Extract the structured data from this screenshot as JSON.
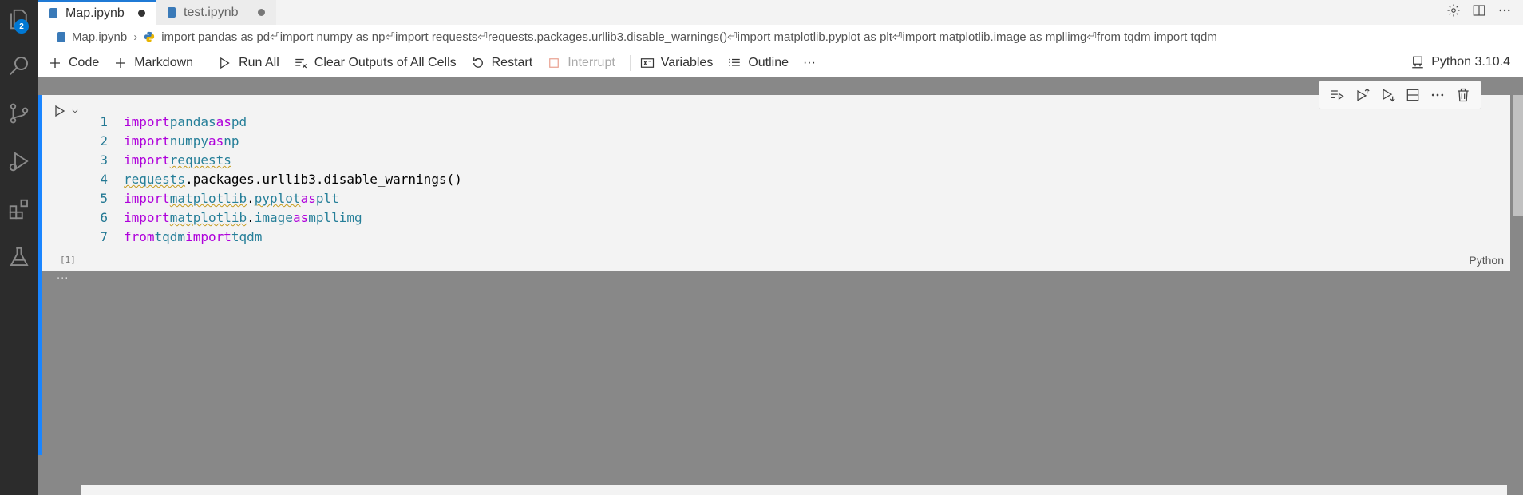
{
  "activity_bar": {
    "items": [
      {
        "icon": "explorer-icon"
      },
      {
        "icon": "search-icon"
      },
      {
        "icon": "source-control-icon"
      },
      {
        "icon": "run-debug-icon"
      },
      {
        "icon": "extensions-icon"
      },
      {
        "icon": "testing-icon"
      }
    ],
    "explorer_badge": "2"
  },
  "tabs": [
    {
      "label": "Map.ipynb",
      "active": true
    },
    {
      "label": "test.ipynb",
      "active": false
    }
  ],
  "breadcrumb": {
    "file": "Map.ipynb",
    "cell": "import pandas as pd⏎import numpy as np⏎import requests⏎requests.packages.urllib3.disable_warnings()⏎import matplotlib.pyplot as plt⏎import matplotlib.image as mpllimg⏎from tqdm import tqdm"
  },
  "toolbar": {
    "code": "Code",
    "markdown": "Markdown",
    "run_all": "Run All",
    "clear_outputs": "Clear Outputs of All Cells",
    "restart": "Restart",
    "interrupt": "Interrupt",
    "variables": "Variables",
    "outline": "Outline",
    "more": "···",
    "kernel": "Python 3.10.4"
  },
  "cell": {
    "line_numbers": [
      "1",
      "2",
      "3",
      "4",
      "5",
      "6",
      "7"
    ],
    "exec_count": "[1]",
    "language": "Python"
  },
  "output": {
    "ellipsis": "···"
  },
  "colors": {
    "accent": "#1a85ff",
    "keyword": "#af00db",
    "module": "#267f99",
    "line_number": "#237893"
  }
}
